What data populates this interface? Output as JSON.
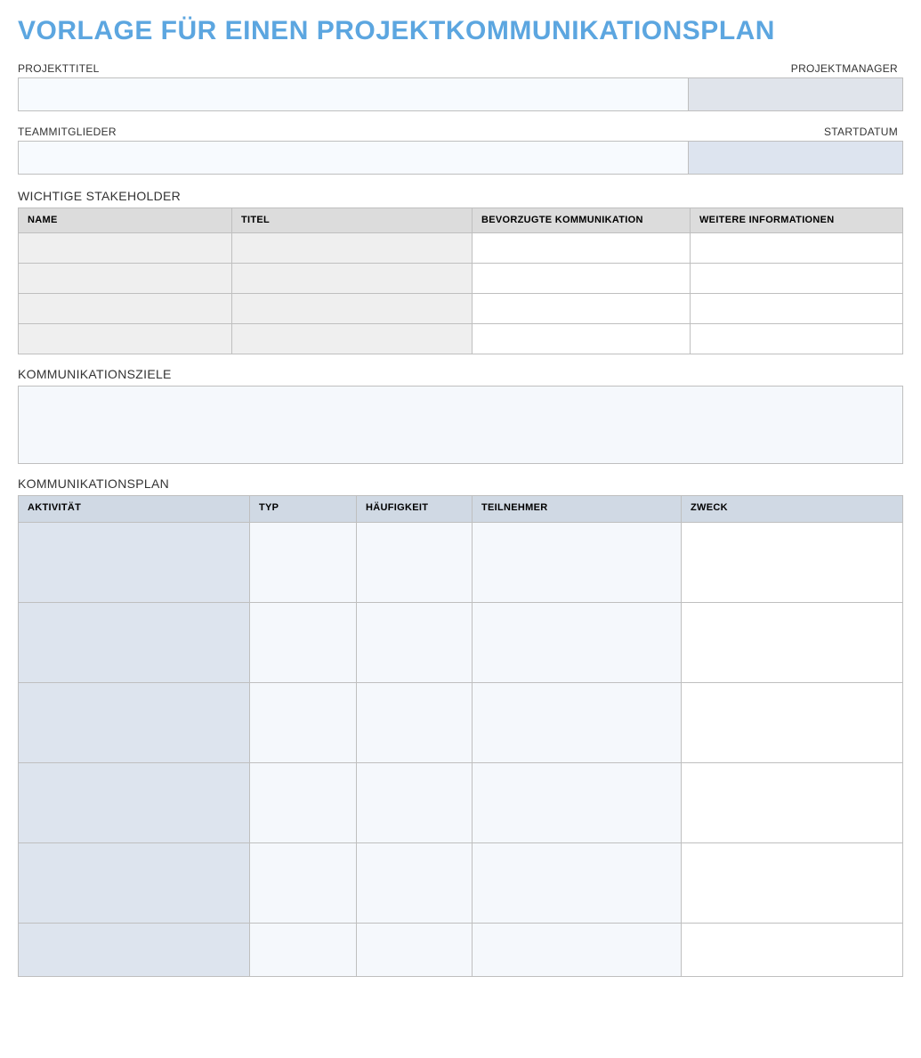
{
  "title": "VORLAGE FÜR EINEN PROJEKTKOMMUNIKATIONSPLAN",
  "project": {
    "title_label": "PROJEKTTITEL",
    "title_value": "",
    "manager_label": "PROJEKTMANAGER",
    "manager_value": "",
    "team_label": "TEAMMITGLIEDER",
    "team_value": "",
    "startdate_label": "STARTDATUM",
    "startdate_value": ""
  },
  "stakeholders": {
    "heading": "WICHTIGE STAKEHOLDER",
    "columns": {
      "name": "NAME",
      "title": "TITEL",
      "comm": "BEVORZUGTE KOMMUNIKATION",
      "info": "WEITERE INFORMATIONEN"
    },
    "rows": [
      {
        "name": "",
        "title": "",
        "comm": "",
        "info": ""
      },
      {
        "name": "",
        "title": "",
        "comm": "",
        "info": ""
      },
      {
        "name": "",
        "title": "",
        "comm": "",
        "info": ""
      },
      {
        "name": "",
        "title": "",
        "comm": "",
        "info": ""
      }
    ]
  },
  "goals": {
    "heading": "KOMMUNIKATIONSZIELE",
    "value": ""
  },
  "plan": {
    "heading": "KOMMUNIKATIONSPLAN",
    "columns": {
      "activity": "AKTIVITÄT",
      "type": "TYP",
      "frequency": "HÄUFIGKEIT",
      "participants": "TEILNEHMER",
      "purpose": "ZWECK"
    },
    "rows": [
      {
        "activity": "",
        "type": "",
        "frequency": "",
        "participants": "",
        "purpose": ""
      },
      {
        "activity": "",
        "type": "",
        "frequency": "",
        "participants": "",
        "purpose": ""
      },
      {
        "activity": "",
        "type": "",
        "frequency": "",
        "participants": "",
        "purpose": ""
      },
      {
        "activity": "",
        "type": "",
        "frequency": "",
        "participants": "",
        "purpose": ""
      },
      {
        "activity": "",
        "type": "",
        "frequency": "",
        "participants": "",
        "purpose": ""
      },
      {
        "activity": "",
        "type": "",
        "frequency": "",
        "participants": "",
        "purpose": ""
      }
    ]
  }
}
